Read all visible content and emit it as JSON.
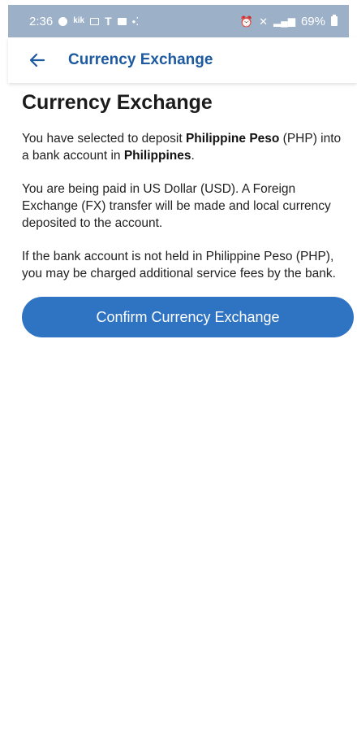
{
  "status_bar": {
    "time": "2:36",
    "left_icons": [
      "facebook-icon",
      "kik-icon",
      "gallery-icon",
      "t-mobile-icon",
      "youtube-icon",
      "dots-icon"
    ],
    "right_icons": [
      "alarm-icon",
      "mute-icon",
      "signal-icon"
    ],
    "battery": "69%",
    "kik_label": "kik",
    "carrier_glyph": "T"
  },
  "app_bar": {
    "title": "Currency Exchange"
  },
  "main": {
    "heading": "Currency Exchange",
    "para1": {
      "pre": "You have selected to deposit ",
      "currency": "Philippine Peso",
      "mid": " (PHP) into a bank account in ",
      "country": "Philippines",
      "post": "."
    },
    "para2": "You are being paid in US Dollar (USD). A Foreign Exchange (FX) transfer will be made and local currency deposited to the account.",
    "para3": "If the bank account is not held in Philippine Peso (PHP), you may be charged additional service fees by the bank.",
    "confirm_label": "Confirm Currency Exchange"
  },
  "colors": {
    "accent": "#2f73c3",
    "title": "#1e5aa0",
    "status_bar": "#9cb0c8"
  }
}
